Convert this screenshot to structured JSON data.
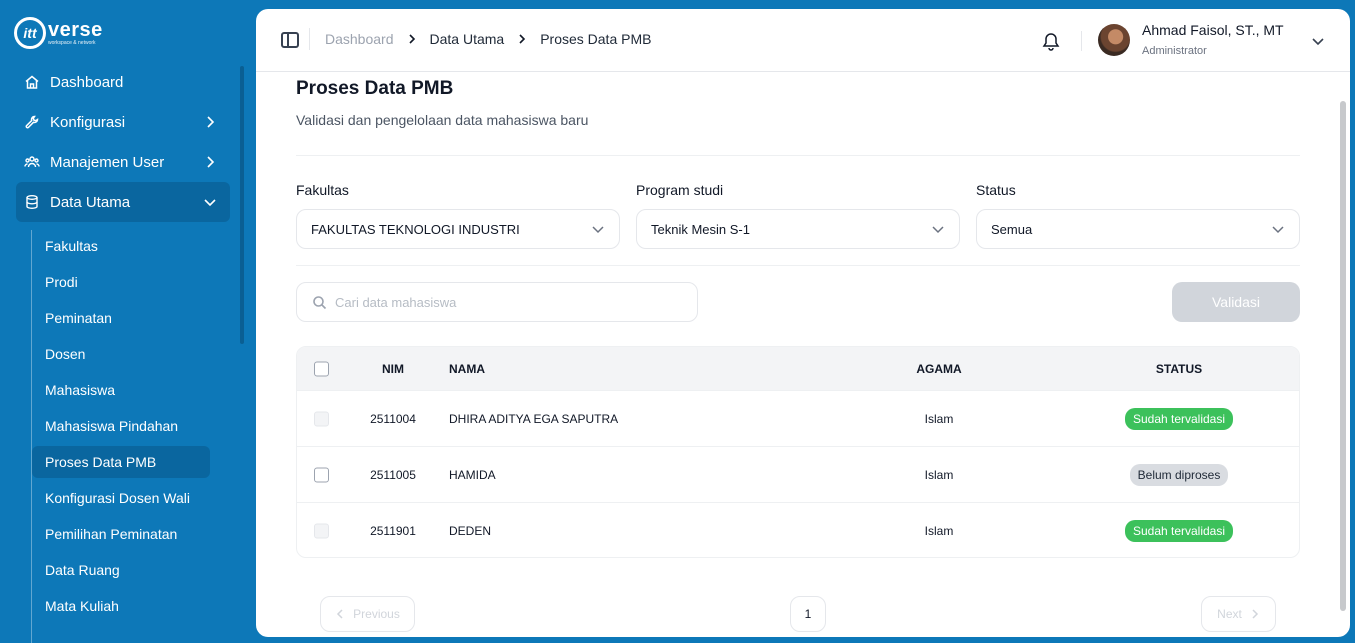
{
  "brand": {
    "mark": "itt",
    "word": "verse",
    "tagline": "workspace & network"
  },
  "sidebar": {
    "items": [
      {
        "label": "Dashboard",
        "icon": "home-icon",
        "has_chevron": false
      },
      {
        "label": "Konfigurasi",
        "icon": "wrench-icon",
        "has_chevron": true
      },
      {
        "label": "Manajemen User",
        "icon": "users-icon",
        "has_chevron": true
      },
      {
        "label": "Data Utama",
        "icon": "database-icon",
        "has_chevron": true,
        "expanded": true
      }
    ],
    "sub_items": [
      "Fakultas",
      "Prodi",
      "Peminatan",
      "Dosen",
      "Mahasiswa",
      "Mahasiswa Pindahan",
      "Proses Data PMB",
      "Konfigurasi Dosen Wali",
      "Pemilihan Peminatan",
      "Data Ruang",
      "Mata Kuliah"
    ],
    "active_sub": "Proses Data PMB"
  },
  "topbar": {
    "breadcrumbs": [
      "Dashboard",
      "Data Utama",
      "Proses Data PMB"
    ],
    "user": {
      "name": "Ahmad Faisol, ST., MT",
      "role": "Administrator"
    }
  },
  "page": {
    "title": "Proses Data PMB",
    "subtitle": "Validasi dan pengelolaan data mahasiswa baru"
  },
  "filters": {
    "fakultas": {
      "label": "Fakultas",
      "value": "FAKULTAS TEKNOLOGI INDUSTRI"
    },
    "prodi": {
      "label": "Program studi",
      "value": "Teknik Mesin S-1"
    },
    "status": {
      "label": "Status",
      "value": "Semua"
    }
  },
  "search": {
    "placeholder": "Cari data mahasiswa",
    "value": ""
  },
  "validate_button": "Validasi",
  "table": {
    "columns": {
      "nim": "NIM",
      "nama": "NAMA",
      "agama": "AGAMA",
      "status": "STATUS"
    },
    "rows": [
      {
        "nim": "2511004",
        "nama": "DHIRA ADITYA EGA SAPUTRA",
        "agama": "Islam",
        "status": "Sudah tervalidasi",
        "validated": true
      },
      {
        "nim": "2511005",
        "nama": "HAMIDA",
        "agama": "Islam",
        "status": "Belum diproses",
        "validated": false
      },
      {
        "nim": "2511901",
        "nama": "DEDEN",
        "agama": "Islam",
        "status": "Sudah tervalidasi",
        "validated": true
      }
    ]
  },
  "pagination": {
    "prev": "Previous",
    "page": "1",
    "next": "Next"
  },
  "colors": {
    "sidebar": "#0d78b8",
    "success": "#3cc15b",
    "pending": "#d9dce1",
    "disabled_button": "#d1d5db"
  }
}
